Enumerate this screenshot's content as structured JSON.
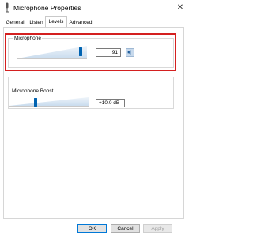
{
  "window": {
    "title": "Microphone Properties",
    "close_glyph": "✕"
  },
  "tabs": [
    {
      "label": "General"
    },
    {
      "label": "Listen"
    },
    {
      "label": "Levels"
    },
    {
      "label": "Advanced"
    }
  ],
  "active_tab": "Levels",
  "microphone": {
    "label": "Microphone",
    "level_value": "91",
    "level_fraction": 0.91
  },
  "boost": {
    "label": "Microphone Boost",
    "value": "+10.0 dB",
    "level_fraction": 0.33
  },
  "buttons": {
    "ok": "OK",
    "cancel": "Cancel",
    "apply": "Apply"
  },
  "icons": {
    "window_icon": "microphone-icon",
    "speaker": "speaker-icon"
  },
  "colors": {
    "accent": "#0063b1",
    "highlight": "#d42020"
  }
}
